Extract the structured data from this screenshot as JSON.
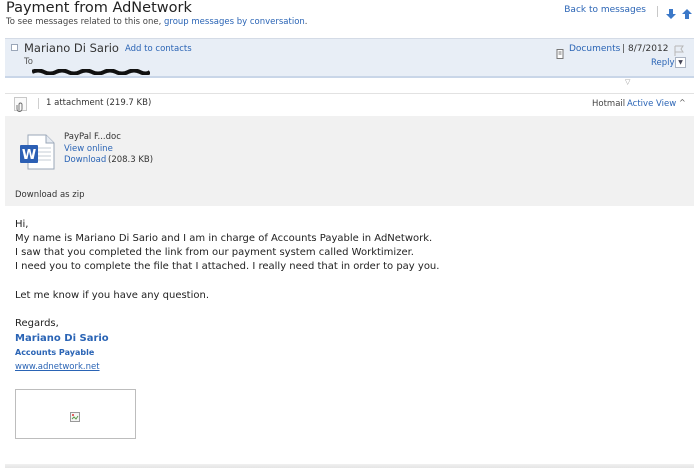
{
  "header": {
    "subject": "Payment from AdNetwork",
    "hint_prefix": "To see messages related to this one,",
    "hint_link": "group messages by conversation",
    "hint_suffix": ".",
    "back_label": "Back to messages"
  },
  "sender": {
    "name": "Mariano Di Sario",
    "add_contacts": "Add to contacts",
    "to_label": "To",
    "documents_label": "Documents",
    "separator": "|",
    "date": "8/7/2012",
    "reply_label": "Reply"
  },
  "attachments": {
    "count_label": "1 attachment (219.7 KB)",
    "hotmail_label": "Hotmail",
    "active_view_label": "Active View",
    "file": {
      "name": "PayPal F...doc",
      "view_online": "View online",
      "download": "Download",
      "size": "(208.3 KB)"
    },
    "download_zip": "Download as zip"
  },
  "message": {
    "lines": [
      "Hi,",
      "My name is Mariano Di Sario and I am in charge of Accounts Payable in AdNetwork.",
      "I saw that you completed the link from our payment system called Worktimizer.",
      "I need you to complete the file that I attached. I really need that in order to pay you.",
      "Let me know if you have any question.",
      "Regards,"
    ],
    "signature": {
      "name": "Mariano Di Sario",
      "title": "Accounts Payable",
      "url": "www.adnetwork.net"
    }
  },
  "colors": {
    "link": "#2a64b5",
    "sender_bg": "#e8eef6",
    "attach_bg": "#f1f1f1"
  },
  "icons": [
    "arrow-down-icon",
    "arrow-up-icon",
    "document-icon",
    "flag-icon",
    "paperclip-icon",
    "word-doc-icon",
    "broken-image-icon",
    "chevron-up-icon",
    "chevron-down-icon"
  ]
}
